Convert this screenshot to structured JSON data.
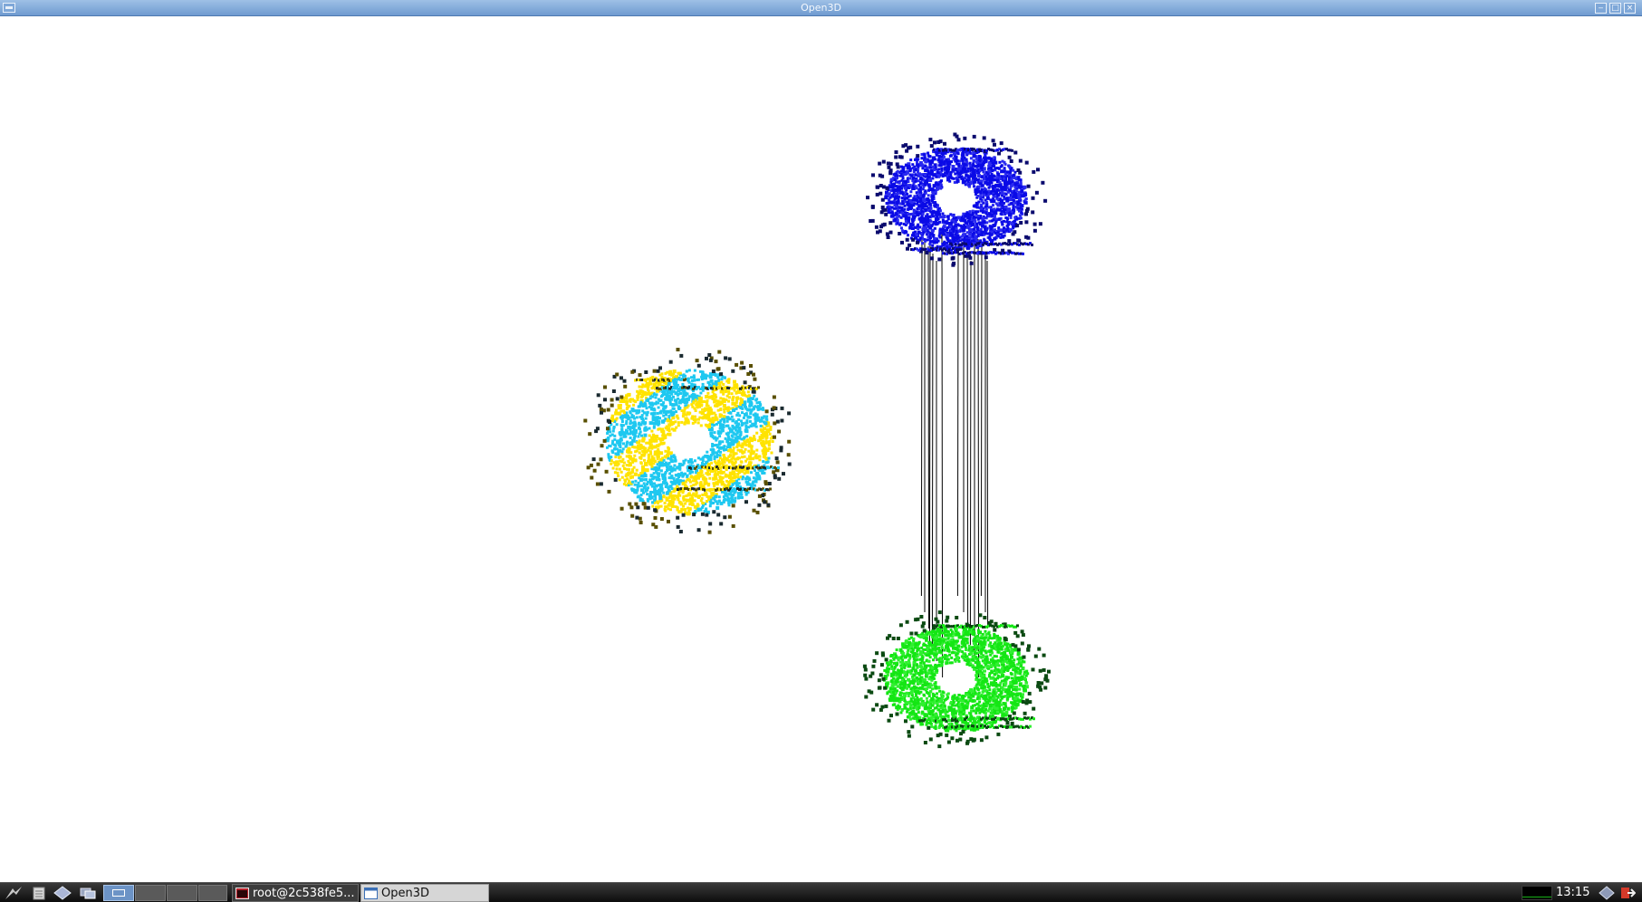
{
  "window": {
    "title": "Open3D",
    "buttons": [
      "minimize",
      "maximize",
      "close"
    ]
  },
  "viewport": {
    "background": "#ffffff",
    "clouds": [
      {
        "role": "source",
        "colors": [
          "#ffe300",
          "#1ec8f0"
        ]
      },
      {
        "role": "target_top",
        "color": "#0a0ae6"
      },
      {
        "role": "target_bottom",
        "color": "#14e614"
      }
    ],
    "correspondence_line_color": "#000000"
  },
  "taskbar": {
    "launchers": [
      "start-menu-icon",
      "file-manager-icon",
      "app-icon",
      "windows-icon"
    ],
    "desktops": [
      "desktop-1",
      "desktop-2",
      "desktop-3",
      "desktop-4"
    ],
    "tasks": [
      {
        "label": "root@2c538fe5...",
        "icon": "terminal-icon"
      },
      {
        "label": "Open3D",
        "icon": "window-icon"
      }
    ],
    "clock": "13:15"
  }
}
